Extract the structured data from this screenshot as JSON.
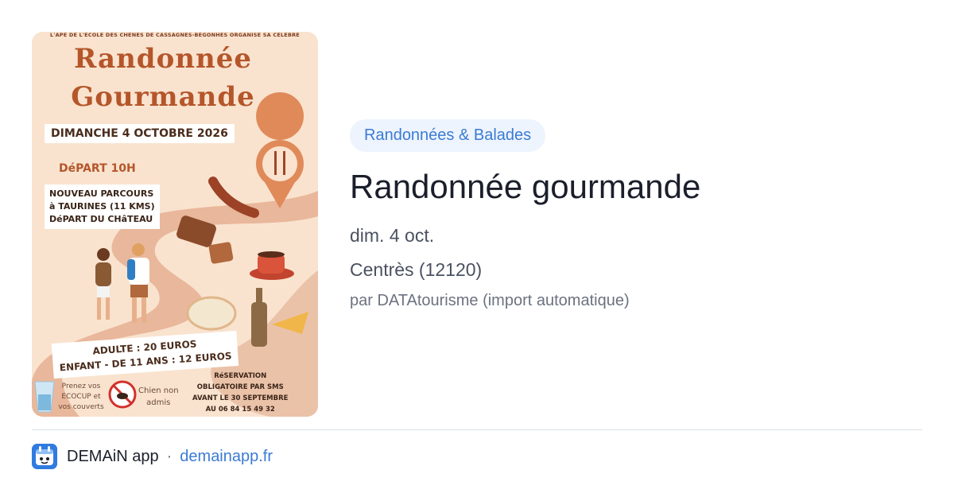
{
  "poster": {
    "organizer": "L'APE DE L'ECOLE DES CHENES DE CASSAGNES-BEGONHES ORGANISE SA CELEBRE",
    "title_line1": "Randonnée",
    "title_line2": "Gourmande",
    "date": "DIMANCHE 4 OCTOBRE 2026",
    "depart": "DéPART 10H",
    "parcours": [
      "NOUVEAU PARCOURS",
      "à TAURINES (11 KMS)",
      "DéPART DU CHâTEAU"
    ],
    "prices": [
      "ADULTE : 20 EUROS",
      "ENFANT - DE 11 ANS : 12 EUROS"
    ],
    "ecocup": "Prenez vos ECOCUP et vos couverts",
    "chien": [
      "Chien non",
      "admis"
    ],
    "reservation": [
      "RéSERVATION",
      "OBLIGATOIRE PAR SMS",
      "AVANT LE 30 SEPTEMBRE",
      "AU 06 84 15 49 32"
    ]
  },
  "event": {
    "category": "Randonnées & Balades",
    "title": "Randonnée gourmande",
    "date": "dim. 4 oct.",
    "location": "Centrès (12120)",
    "source": "par DATAtourisme (import automatique)"
  },
  "footer": {
    "app_icon": "demain-app-logo",
    "app_name": "DEMAiN app",
    "separator": "·",
    "domain": "demainapp.fr"
  },
  "colors": {
    "accent": "#3b7bd4",
    "category_bg": "#eef4fd",
    "title": "#1b1f2b",
    "poster_bg": "#f9e3cf",
    "poster_title": "#b5562a"
  }
}
